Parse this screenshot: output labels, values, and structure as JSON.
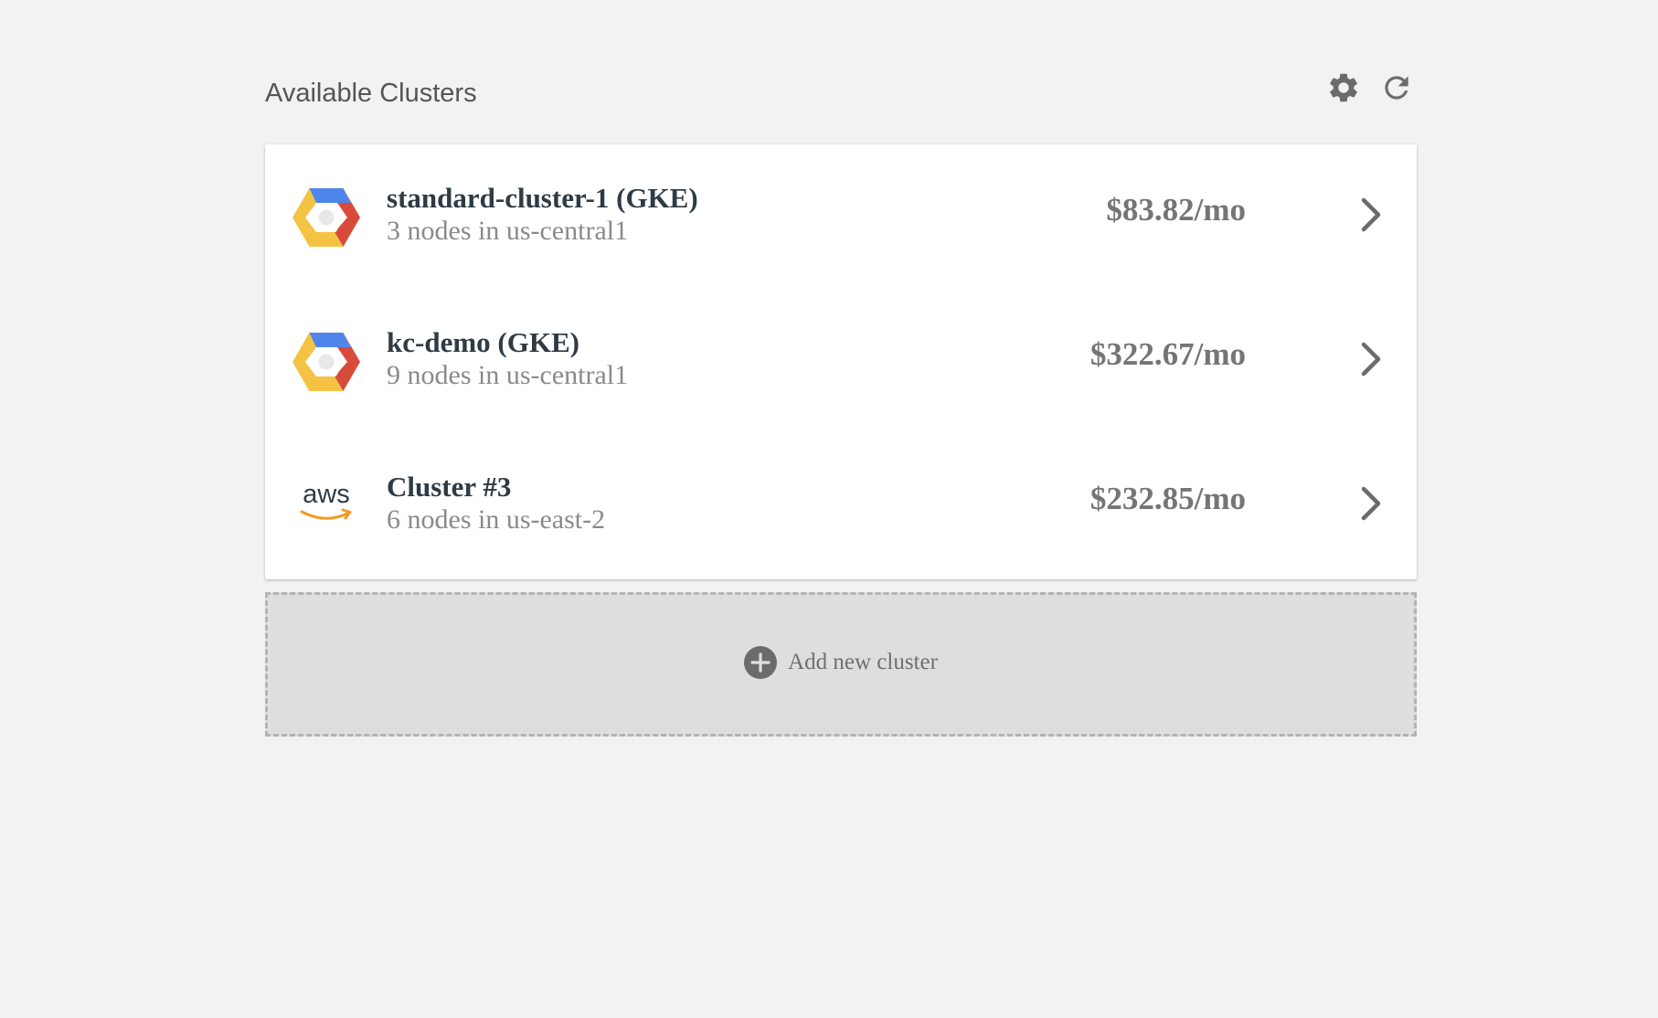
{
  "header": {
    "title": "Available Clusters",
    "settings_icon": "gear-icon",
    "refresh_icon": "refresh-icon"
  },
  "clusters": [
    {
      "provider": "GKE",
      "logo_icon": "google-cloud-hexagon-icon",
      "name": "standard-cluster-1 (GKE)",
      "detail": "3 nodes in us-central1",
      "price": "$83.82/mo"
    },
    {
      "provider": "GKE",
      "logo_icon": "google-cloud-hexagon-icon",
      "name": "kc-demo (GKE)",
      "detail": "9 nodes in us-central1",
      "price": "$322.67/mo"
    },
    {
      "provider": "AWS",
      "logo_icon": "aws-logo-icon",
      "logo_text": "aws",
      "name": "Cluster #3",
      "detail": "6 nodes in us-east-2",
      "price": "$232.85/mo"
    }
  ],
  "add_cluster": {
    "label": "Add new cluster",
    "icon": "plus-circle-icon"
  },
  "colors": {
    "background": "#f2f2f2",
    "card": "#ffffff",
    "icon_gray": "#6b6b6b",
    "name_text": "#2f3b44",
    "detail_text": "#8a8a8a",
    "price_text": "#757575",
    "gcp_blue": "#4f86ec",
    "gcp_red": "#d84b3a",
    "gcp_yellow": "#f5c343",
    "aws_orange": "#f39a1f"
  }
}
